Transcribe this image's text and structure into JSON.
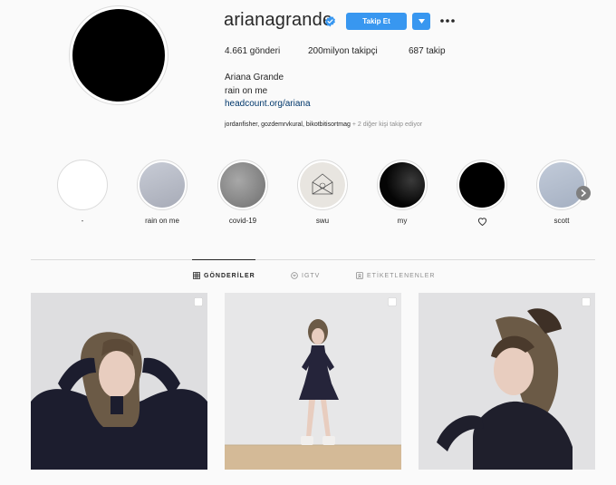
{
  "profile": {
    "username": "arianagrande",
    "follow_label": "Takip Et",
    "stats": {
      "posts": "4.661 gönderi",
      "followers": "200milyon takipçi",
      "following": "687 takip"
    },
    "full_name": "Ariana Grande",
    "bio": "rain on me",
    "link": "headcount.org/ariana",
    "followed_by_names": "jordanfisher, gozdemrvkural, bikotbitisortmag",
    "followed_by_more": " + 2 diğer kişi takip ediyor"
  },
  "highlights": [
    {
      "label": "-",
      "color": "#ffffff"
    },
    {
      "label": "rain on me",
      "color": "#b9bcc6"
    },
    {
      "label": "covid-19",
      "color": "#8c8c8c"
    },
    {
      "label": "swu",
      "color": "#e4e1dc"
    },
    {
      "label": "my",
      "color": "#0d0d0d"
    },
    {
      "label": "",
      "icon": "heart-icon",
      "color": "#000000"
    },
    {
      "label": "scott",
      "color": "#b5bfcf"
    }
  ],
  "tabs": [
    {
      "label": "GÖNDERİLER",
      "icon": "grid-icon",
      "active": true
    },
    {
      "label": "IGTV",
      "icon": "igtv-icon",
      "active": false
    },
    {
      "label": "ETİKETLENENLER",
      "icon": "tagged-icon",
      "active": false
    }
  ],
  "colors": {
    "accent": "#3897f0",
    "link": "#00376b",
    "verified": "#3897f0"
  }
}
